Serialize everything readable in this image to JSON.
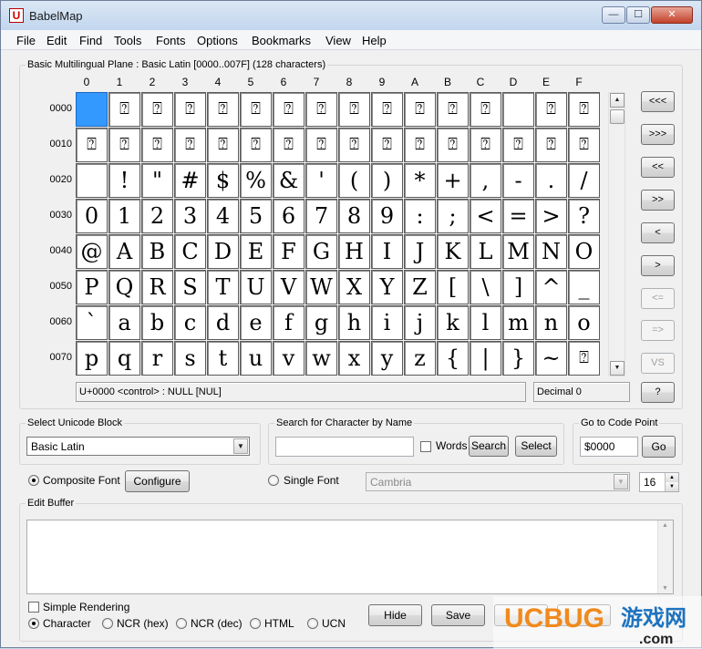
{
  "window": {
    "title": "BabelMap",
    "icon_glyph": "U",
    "controls": [
      "—",
      "☐",
      "✕"
    ]
  },
  "menu": [
    "File",
    "Edit",
    "Find",
    "Tools",
    "Fonts",
    "Options",
    "Bookmarks",
    "View",
    "Help"
  ],
  "chart_group": {
    "legend": "Basic Multilingual Plane : Basic Latin [0000..007F] (128 characters)",
    "column_headers": [
      "0",
      "1",
      "2",
      "3",
      "4",
      "5",
      "6",
      "7",
      "8",
      "9",
      "A",
      "B",
      "C",
      "D",
      "E",
      "F"
    ],
    "row_labels": [
      "0000",
      "0010",
      "0020",
      "0030",
      "0040",
      "0050",
      "0060",
      "0070"
    ],
    "rows": [
      [
        "",
        "⍰",
        "⍰",
        "⍰",
        "⍰",
        "⍰",
        "⍰",
        "⍰",
        "⍰",
        "⍰",
        "⍰",
        "⍰",
        "⍰",
        "",
        "⍰",
        "⍰"
      ],
      [
        "⍰",
        "⍰",
        "⍰",
        "⍰",
        "⍰",
        "⍰",
        "⍰",
        "⍰",
        "⍰",
        "⍰",
        "⍰",
        "⍰",
        "⍰",
        "⍰",
        "⍰",
        "⍰"
      ],
      [
        "",
        "!",
        "\"",
        "#",
        "$",
        "%",
        "&",
        "'",
        "(",
        ")",
        "*",
        "+",
        ",",
        "-",
        ".",
        "/"
      ],
      [
        "0",
        "1",
        "2",
        "3",
        "4",
        "5",
        "6",
        "7",
        "8",
        "9",
        ":",
        ";",
        "<",
        "=",
        ">",
        "?"
      ],
      [
        "@",
        "A",
        "B",
        "C",
        "D",
        "E",
        "F",
        "G",
        "H",
        "I",
        "J",
        "K",
        "L",
        "M",
        "N",
        "O"
      ],
      [
        "P",
        "Q",
        "R",
        "S",
        "T",
        "U",
        "V",
        "W",
        "X",
        "Y",
        "Z",
        "[",
        "\\",
        "]",
        "^",
        "_"
      ],
      [
        "`",
        "a",
        "b",
        "c",
        "d",
        "e",
        "f",
        "g",
        "h",
        "i",
        "j",
        "k",
        "l",
        "m",
        "n",
        "o"
      ],
      [
        "p",
        "q",
        "r",
        "s",
        "t",
        "u",
        "v",
        "w",
        "x",
        "y",
        "z",
        "{",
        "|",
        "}",
        "~",
        "⍰"
      ]
    ],
    "selected_cell": "0000",
    "status_left": "U+0000 <control> : NULL [NUL]",
    "status_right": "Decimal 0"
  },
  "nav_buttons": [
    {
      "label": "<<<",
      "disabled": false
    },
    {
      "label": ">>>",
      "disabled": false
    },
    {
      "label": "<<",
      "disabled": false
    },
    {
      "label": ">>",
      "disabled": false
    },
    {
      "label": "<",
      "disabled": false
    },
    {
      "label": ">",
      "disabled": false
    },
    {
      "label": "<=",
      "disabled": true
    },
    {
      "label": "=>",
      "disabled": true
    },
    {
      "label": "VS",
      "disabled": true
    },
    {
      "label": "?",
      "disabled": false
    }
  ],
  "unicode_block": {
    "legend": "Select Unicode Block",
    "value": "Basic Latin"
  },
  "search": {
    "legend": "Search for Character by Name",
    "value": "",
    "words_label": "Words",
    "search_label": "Search",
    "select_label": "Select"
  },
  "goto": {
    "legend": "Go to Code Point",
    "value": "$0000",
    "go_label": "Go"
  },
  "font": {
    "composite_label": "Composite Font",
    "configure_label": "Configure",
    "single_label": "Single Font",
    "single_font_value": "Cambria",
    "size_value": "16"
  },
  "edit_buffer": {
    "legend": "Edit Buffer",
    "simple_rendering_label": "Simple Rendering",
    "formats": [
      "Character",
      "NCR (hex)",
      "NCR (dec)",
      "HTML",
      "UCN"
    ],
    "hide_label": "Hide",
    "save_label": "Save"
  },
  "watermark": {
    "brand": "UCBUG",
    "cn": "游戏网",
    "domain": ".com"
  },
  "colors": {
    "selected": "#3399ff",
    "watermark_orange": "#f08a1c",
    "watermark_blue": "#1e73be"
  }
}
